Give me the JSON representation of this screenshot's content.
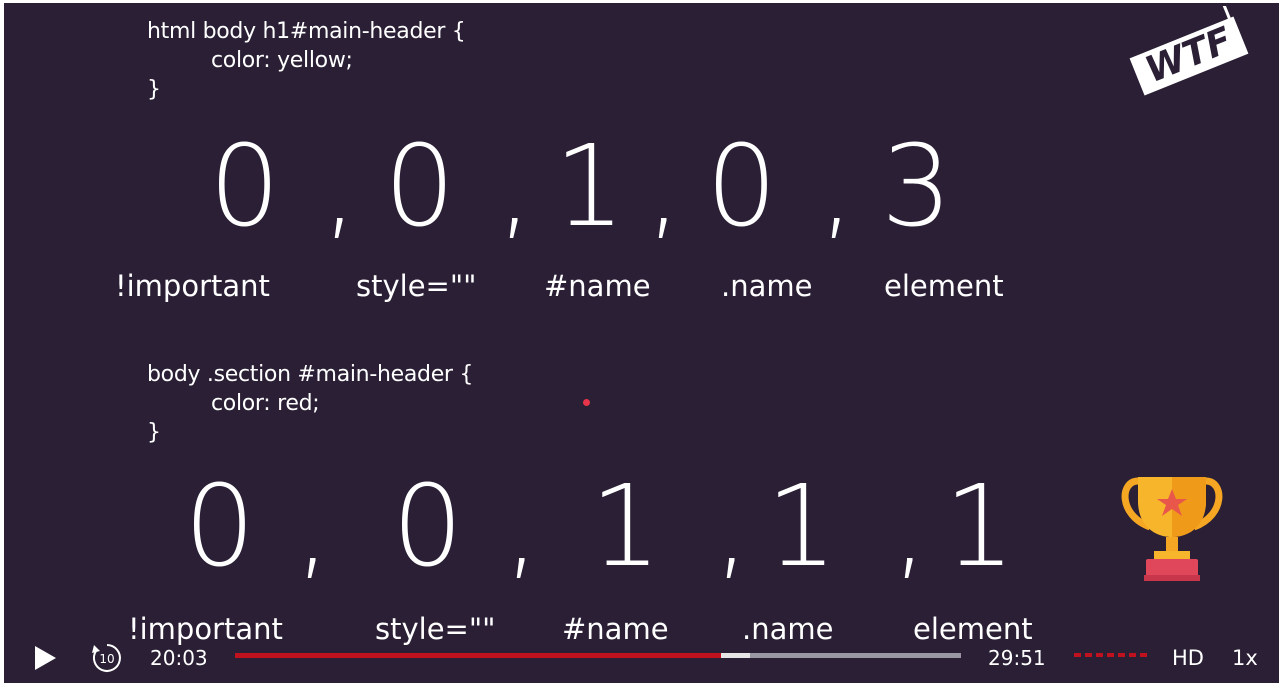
{
  "video": {
    "rule_1": {
      "selector_line": "html body h1#main-header {",
      "property_line": "color: yellow;",
      "closing_brace": "}",
      "specificity": [
        "0",
        "0",
        "1",
        "0",
        "3"
      ],
      "separator": ","
    },
    "rule_2": {
      "selector_line": "body .section #main-header {",
      "property_line": "color: red;",
      "closing_brace": "}",
      "specificity": [
        "0",
        "0",
        "1",
        "1",
        "1"
      ],
      "separator": ","
    },
    "labels": [
      "!important",
      "style=\"\"",
      "#name",
      ".name",
      "element"
    ],
    "logo": {
      "text": "WTF",
      "icon": "wtf-logo-icon"
    },
    "winner_icon": "trophy-icon",
    "colors": {
      "background": "#2a1f35",
      "accent": "#c0121e",
      "laser": "#e8344a"
    }
  },
  "player": {
    "current_time": "20:03",
    "total_time": "29:51",
    "played_fraction": 0.67,
    "buffered_fraction": 0.71,
    "quality_label": "HD",
    "speed_label": "1x",
    "rewind_label": "10",
    "play_icon": "play-icon"
  }
}
